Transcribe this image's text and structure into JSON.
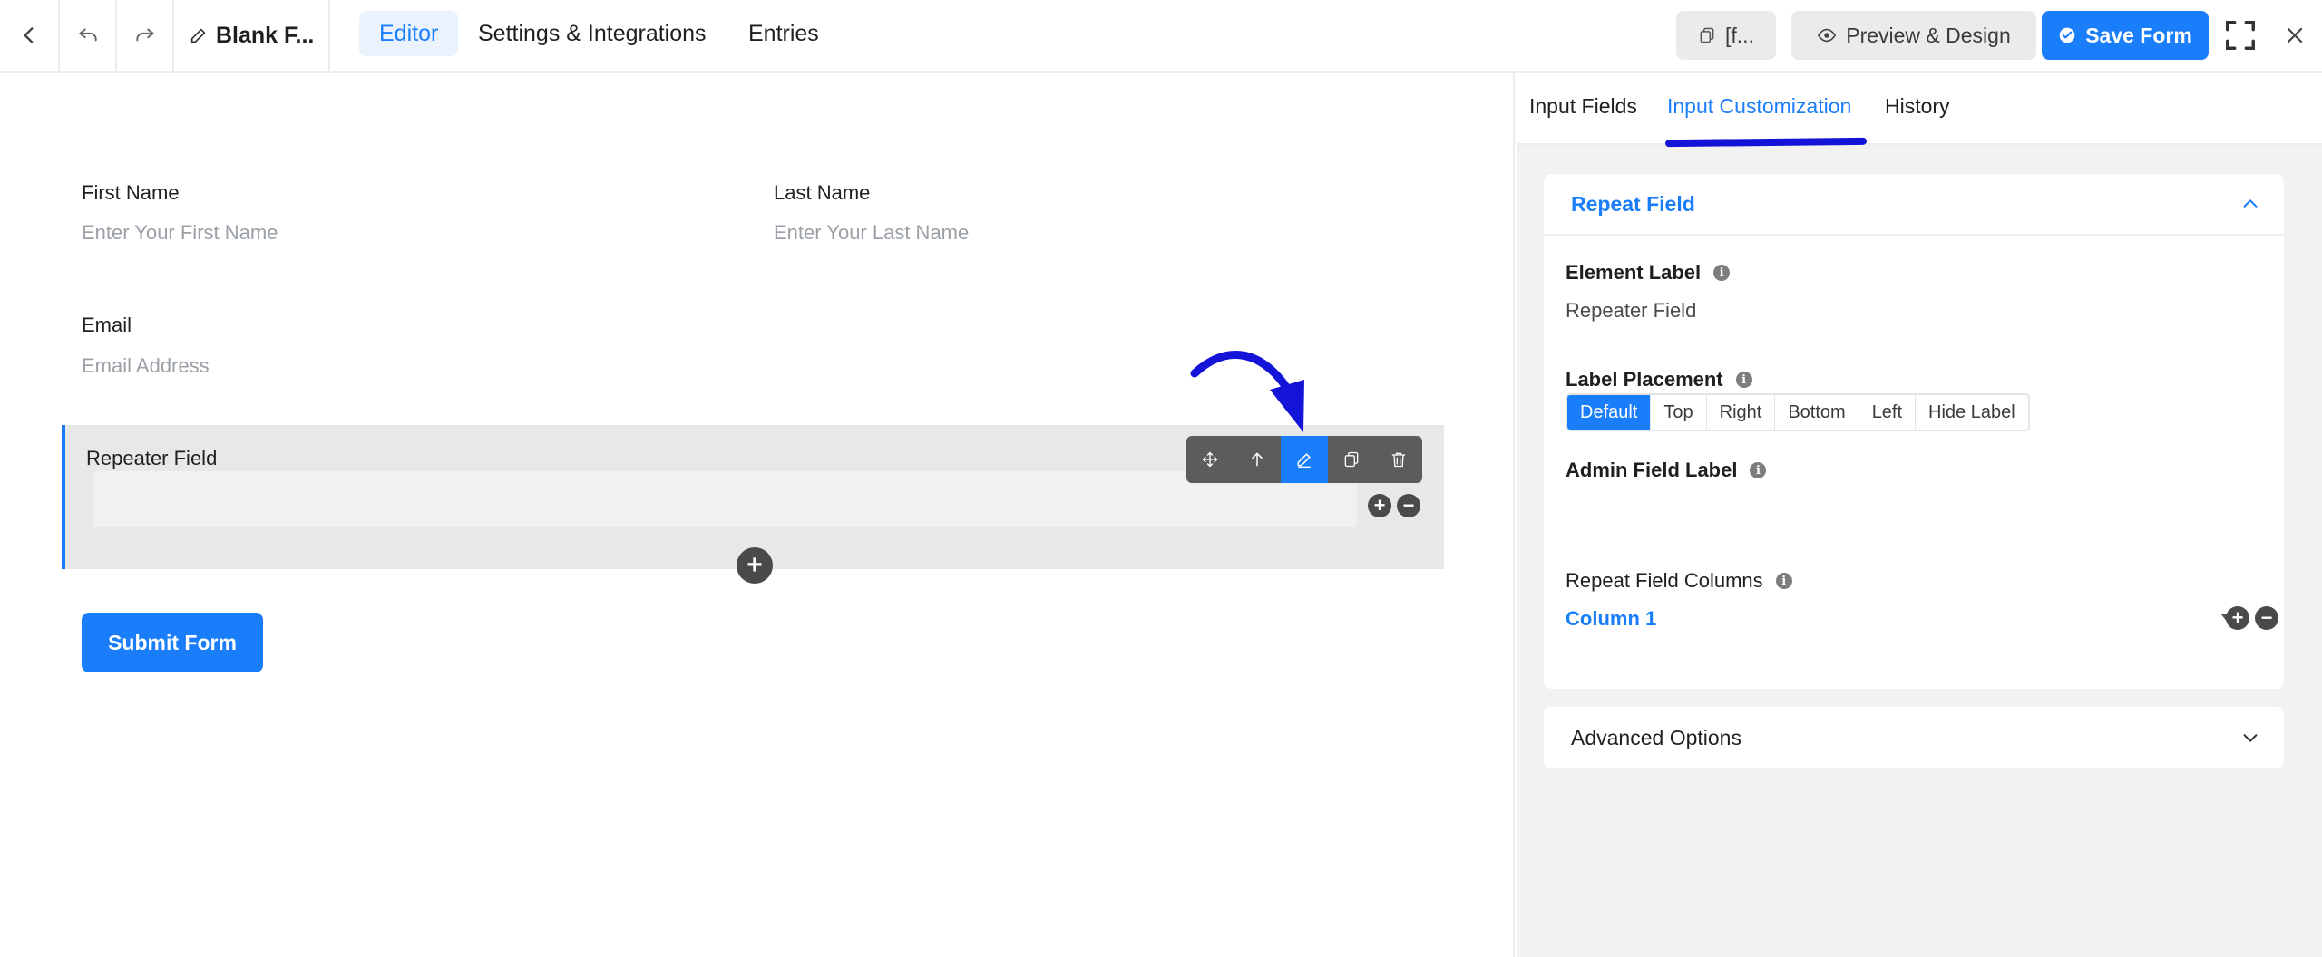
{
  "header": {
    "title": "Blank F...",
    "tabs": [
      {
        "label": "Editor",
        "active": true
      },
      {
        "label": "Settings & Integrations",
        "active": false
      },
      {
        "label": "Entries",
        "active": false
      }
    ],
    "shortcode_label": "[f...",
    "preview_label": "Preview & Design",
    "save_label": "Save Form"
  },
  "form": {
    "first_name": {
      "label": "First Name",
      "placeholder": "Enter Your First Name"
    },
    "last_name": {
      "label": "Last Name",
      "placeholder": "Enter Your Last Name"
    },
    "email": {
      "label": "Email",
      "placeholder": "Email Address"
    },
    "repeater": {
      "label": "Repeater Field"
    },
    "submit_label": "Submit Form"
  },
  "panel": {
    "tabs": [
      {
        "label": "Input Fields",
        "active": false
      },
      {
        "label": "Input Customization",
        "active": true
      },
      {
        "label": "History",
        "active": false
      }
    ],
    "section_title": "Repeat Field",
    "element_label": {
      "title": "Element Label",
      "value": "Repeater Field"
    },
    "label_placement": {
      "title": "Label Placement",
      "options": [
        "Default",
        "Top",
        "Right",
        "Bottom",
        "Left",
        "Hide Label"
      ],
      "selected": "Default"
    },
    "admin_field_label": {
      "title": "Admin Field Label",
      "value": ""
    },
    "repeat_columns": {
      "title": "Repeat Field Columns",
      "columns": [
        "Column 1"
      ]
    },
    "advanced_title": "Advanced Options"
  },
  "colors": {
    "accent": "#1a7efb",
    "annotation": "#1414d9"
  }
}
